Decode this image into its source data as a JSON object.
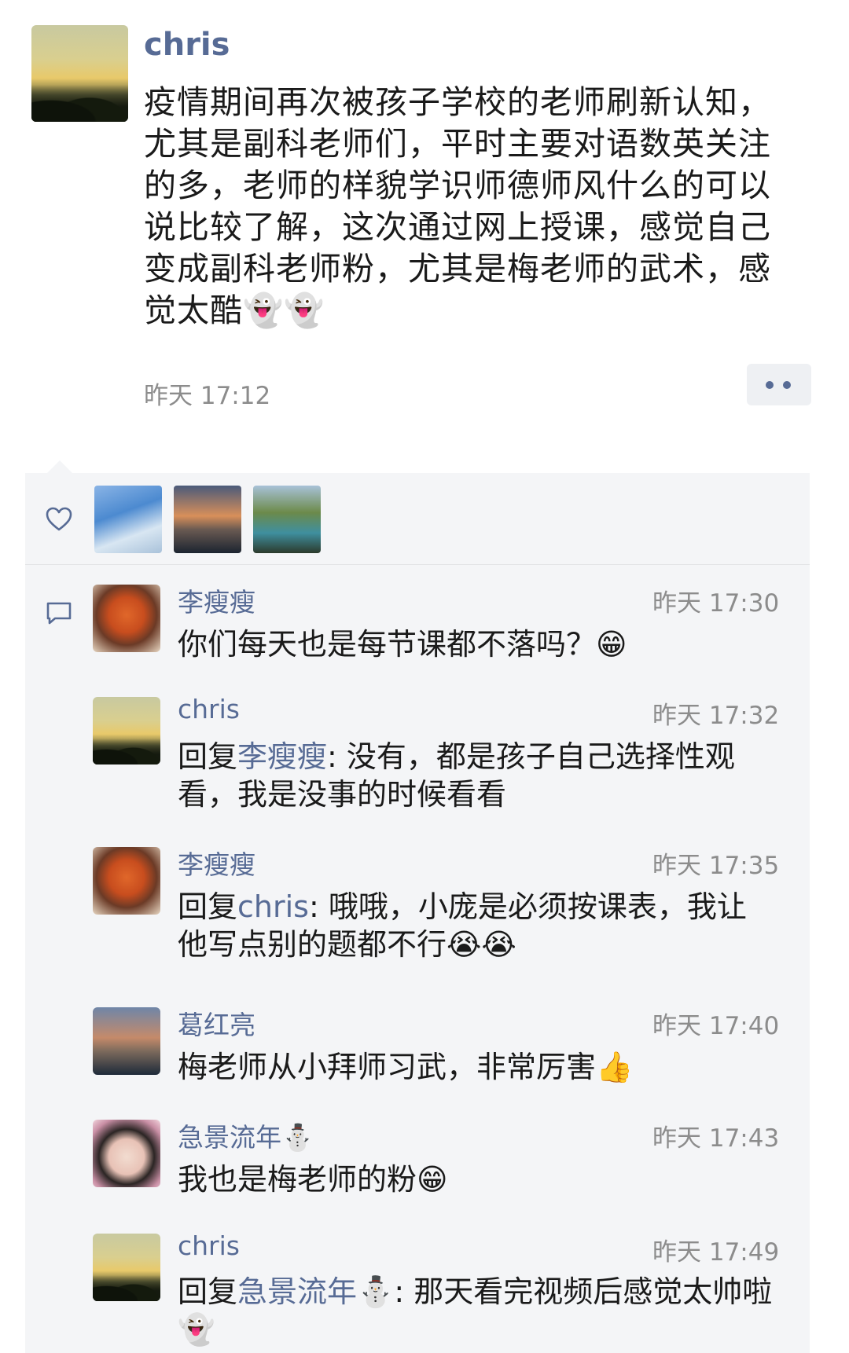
{
  "post": {
    "author": "chris",
    "text": "疫情期间再次被孩子学校的老师刷新认知，尤其是副科老师们，平时主要对语数英关注的多，老师的样貌学识师德师风什么的可以说比较了解，这次通过网上授课，感觉自己变成副科老师粉，尤其是梅老师的武术，感觉太酷👻👻",
    "time": "昨天 17:12"
  },
  "icons": {
    "like": "heart-icon",
    "comment": "comment-icon",
    "more": "more-dots-icon"
  },
  "colors": {
    "name_link": "#576b95",
    "panel_bg": "#f4f5f7",
    "time_gray": "#8c8c8c"
  },
  "comments": [
    {
      "author": "李瘦瘦",
      "time": "昨天 17:30",
      "reply_prefix": "",
      "reply_to": "",
      "separator": "",
      "text": "你们每天也是每节课都不落吗？😁"
    },
    {
      "author": "chris",
      "time": "昨天 17:32",
      "reply_prefix": "回复",
      "reply_to": "李瘦瘦",
      "separator": ": ",
      "text": "没有，都是孩子自己选择性观看，我是没事的时候看看"
    },
    {
      "author": "李瘦瘦",
      "time": "昨天 17:35",
      "reply_prefix": "回复",
      "reply_to": "chris",
      "separator": ": ",
      "text": "哦哦，小庞是必须按课表，我让他写点别的题都不行😭😭"
    },
    {
      "author": "葛红亮",
      "time": "昨天 17:40",
      "reply_prefix": "",
      "reply_to": "",
      "separator": "",
      "text": "梅老师从小拜师习武，非常厉害👍"
    },
    {
      "author": "急景流年⛄",
      "time": "昨天 17:43",
      "reply_prefix": "",
      "reply_to": "",
      "separator": "",
      "text": "我也是梅老师的粉😁"
    },
    {
      "author": "chris",
      "time": "昨天 17:49",
      "reply_prefix": "回复",
      "reply_to": "急景流年⛄",
      "separator": ": ",
      "text": "那天看完视频后感觉太帅啦👻"
    }
  ]
}
